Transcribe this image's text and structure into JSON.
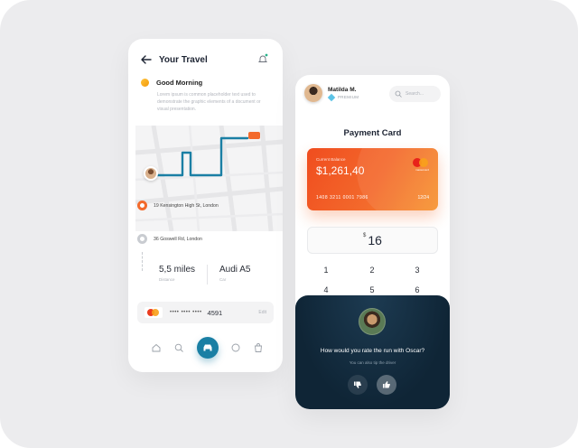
{
  "travel": {
    "title": "Your Travel",
    "greeting": "Good Morning",
    "greeting_desc": "Lorem ipsum is common placeholder text used to demonstrate the graphic elements of a document or visual presentation.",
    "stops": [
      {
        "address": "19 Kensington High St, London",
        "color": "#f36a2c"
      },
      {
        "address": "36 Goswell Rd, London",
        "color": "#c9ccd1"
      }
    ],
    "stats": [
      {
        "value": "5,5 miles",
        "label": "Distance"
      },
      {
        "value": "Audi A5",
        "label": "Car"
      }
    ],
    "card": {
      "masked": "•••• •••• ••••",
      "last4": "4591",
      "edit_label": "Edit"
    },
    "nav": [
      "home-icon",
      "search-icon",
      "car-icon",
      "chat-icon",
      "bag-icon"
    ],
    "accent": "#1a7fa4"
  },
  "payment": {
    "user": {
      "name": "Matilda M.",
      "tier": "PREMIUM"
    },
    "search_placeholder": "Search...",
    "heading": "Payment Card",
    "card": {
      "balance_label": "Current Balance",
      "balance": "$1,261,40",
      "number": "1408 3211 0001 7986",
      "expiry": "12/24",
      "brand": "mastercard",
      "color": "#f36a2c"
    },
    "amount": {
      "currency": "$",
      "value": "16"
    },
    "keypad": [
      "1",
      "2",
      "3",
      "4",
      "5",
      "6"
    ]
  },
  "rating": {
    "question": "How would you rate the run with Oscar?",
    "subtitle": "You can also tip the driver"
  }
}
